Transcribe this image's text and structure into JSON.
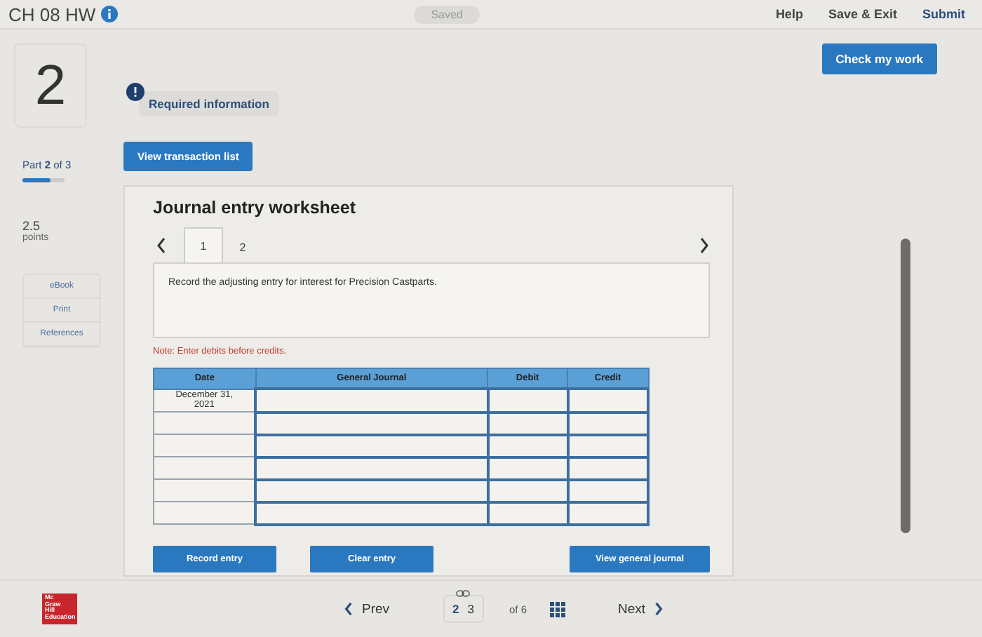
{
  "header": {
    "title": "CH 08 HW",
    "status": "Saved",
    "links": [
      "Help",
      "Save & Exit",
      "Submit"
    ]
  },
  "question": {
    "number": "2",
    "required_info": "Required information",
    "check_button": "Check my work"
  },
  "sidebar": {
    "part": "Part **2** of 3",
    "level": 0.67,
    "points": "2.5",
    "points_label": "points",
    "tools": [
      "eBook",
      "Print",
      "References"
    ]
  },
  "view_button": "View transaction list",
  "worksheet": {
    "title": "Journal entry worksheet",
    "tabs": [
      {
        "label": "1",
        "selected": true
      },
      {
        "label": "2",
        "selected": false
      }
    ],
    "instruction": "Record the adjusting entry for interest for Precision Castparts.",
    "note": "Note: Enter debits before credits.",
    "columns": [
      "Date",
      "General Journal",
      "Debit",
      "Credit"
    ],
    "rows": [
      {
        "date": "December 31, 2021"
      },
      {},
      {},
      {},
      {},
      {}
    ],
    "buttons": [
      "Record entry",
      "Clear entry",
      "View general journal"
    ]
  },
  "footer": {
    "logo": [
      "Mc",
      "Graw",
      "Hill",
      "Education"
    ],
    "prev": "Prev",
    "pages": [
      {
        "label": "2",
        "selected": true
      },
      {
        "label": "3",
        "selected": false
      }
    ],
    "total": "of 6",
    "next": "Next"
  }
}
